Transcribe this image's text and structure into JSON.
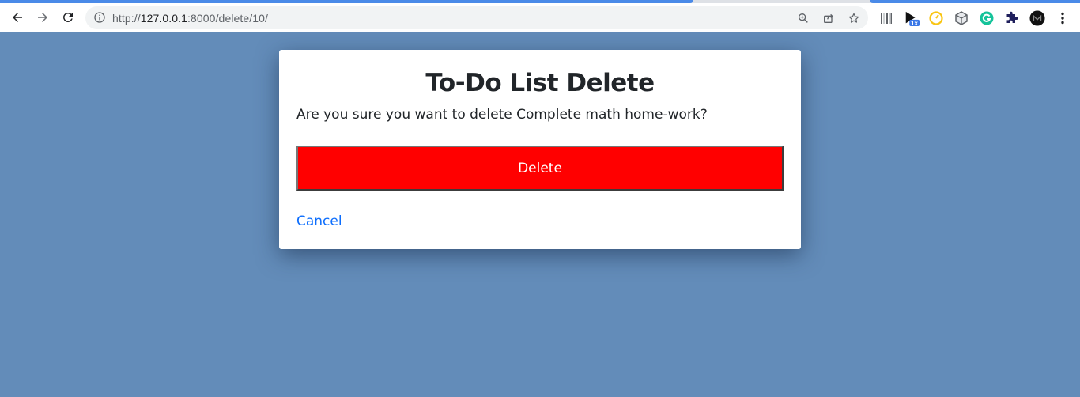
{
  "browser": {
    "url_scheme": "http://",
    "url_host": "127.0.0.1",
    "url_path": ":8000/delete/10/",
    "extensions": [
      "barcode-icon",
      "video-speed-icon",
      "timer-icon",
      "cube-icon",
      "grammarly-icon",
      "puzzle-icon",
      "profile-avatar"
    ],
    "speed_badge": "1x"
  },
  "dialog": {
    "title": "To-Do List Delete",
    "message": "Are you sure you want to delete Complete math home-work?",
    "delete_label": "Delete",
    "cancel_label": "Cancel"
  },
  "colors": {
    "page_bg": "#638cb9",
    "delete_btn": "#ff0000",
    "link": "#0d6efd"
  }
}
